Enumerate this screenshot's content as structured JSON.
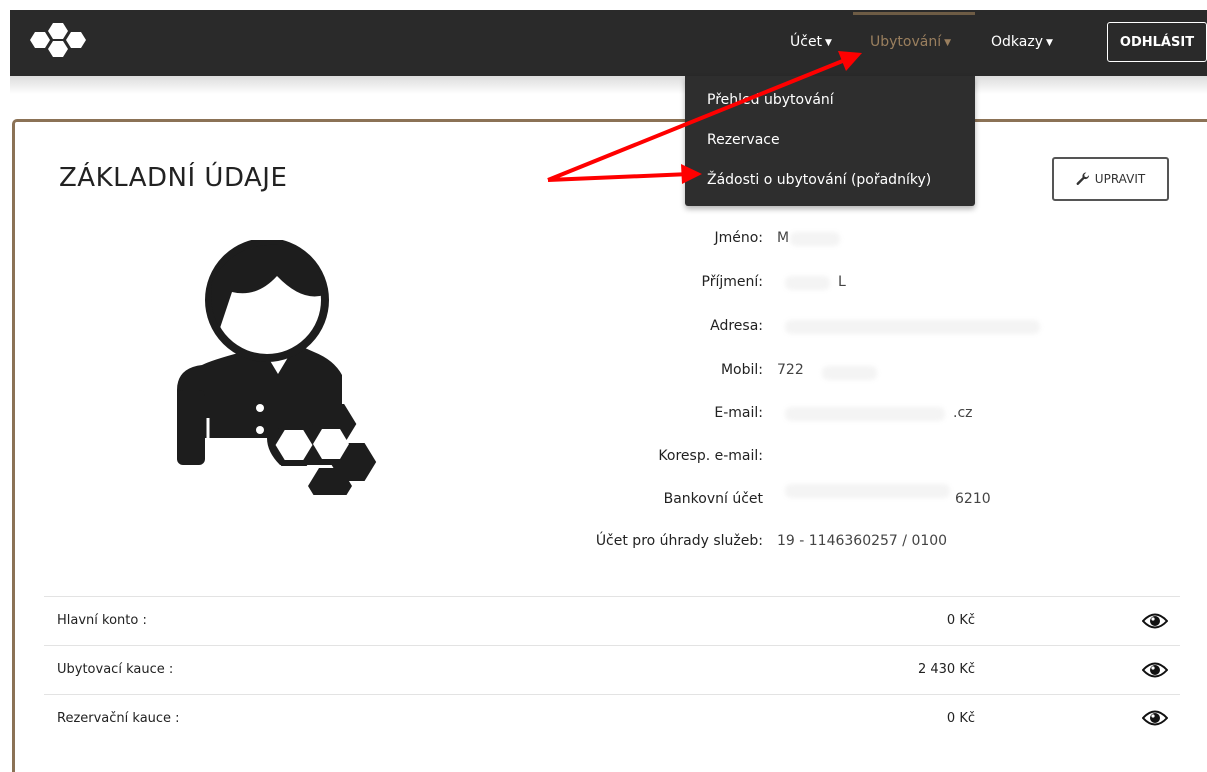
{
  "nav": {
    "items": [
      {
        "label": "Účet",
        "active": false
      },
      {
        "label": "Ubytování",
        "active": true
      },
      {
        "label": "Odkazy",
        "active": false
      }
    ],
    "logout_label": "ODHLÁSIT"
  },
  "dropdown": {
    "items": [
      {
        "label": "Přehled ubytování"
      },
      {
        "label": "Rezervace"
      },
      {
        "label": "Žádosti o ubytování (pořadníky)"
      }
    ]
  },
  "profile": {
    "title": "ZÁKLADNÍ ÚDAJE",
    "edit_label": "UPRAVIT",
    "fields": [
      {
        "label": "Jméno:",
        "value": "M"
      },
      {
        "label": "Příjmení:",
        "value": "L"
      },
      {
        "label": "Adresa:",
        "value": ""
      },
      {
        "label": "Mobil:",
        "value": "722"
      },
      {
        "label": "E-mail:",
        "value": ".cz"
      },
      {
        "label": "Koresp. e-mail:",
        "value": ""
      },
      {
        "label": "Bankovní účet",
        "value": "6210"
      },
      {
        "label": "Účet pro úhrady služeb:",
        "value": "19 - 1146360257 / 0100"
      }
    ]
  },
  "accounts": [
    {
      "label": "Hlavní konto :",
      "amount": "0 Kč"
    },
    {
      "label": "Ubytovací kauce :",
      "amount": "2 430 Kč"
    },
    {
      "label": "Rezervační kauce :",
      "amount": "0 Kč"
    }
  ],
  "colors": {
    "topbar": "#2a2a2a",
    "accent_brown": "#8b7256",
    "active_nav": "#9a7f5e",
    "annotation_arrow": "#ff0000"
  },
  "icons": {
    "logo": "honeycomb-logo-icon",
    "edit": "wrench-icon",
    "account_detail": "eye-icon",
    "avatar": "user-avatar-icon"
  }
}
